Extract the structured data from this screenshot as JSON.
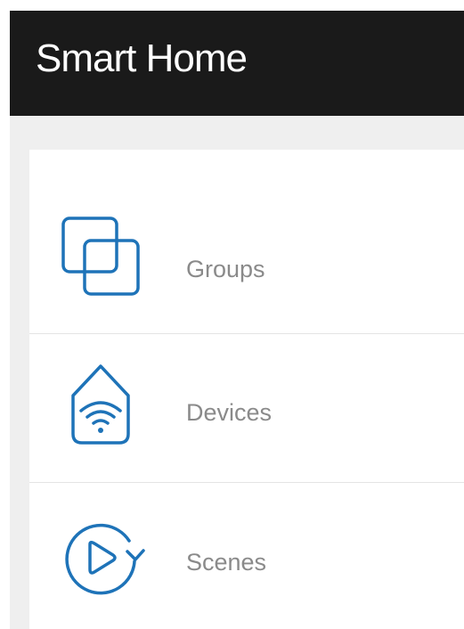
{
  "header": {
    "title": "Smart Home"
  },
  "menu": {
    "items": [
      {
        "label": "Groups",
        "icon": "groups-icon"
      },
      {
        "label": "Devices",
        "icon": "devices-icon"
      },
      {
        "label": "Scenes",
        "icon": "scenes-icon"
      }
    ]
  },
  "colors": {
    "header_background": "#1a1a1a",
    "header_text": "#ffffff",
    "page_background": "#efefef",
    "icon_blue": "#1e73b8",
    "label_text": "#8a8a8a",
    "divider": "#e4e4e4"
  }
}
